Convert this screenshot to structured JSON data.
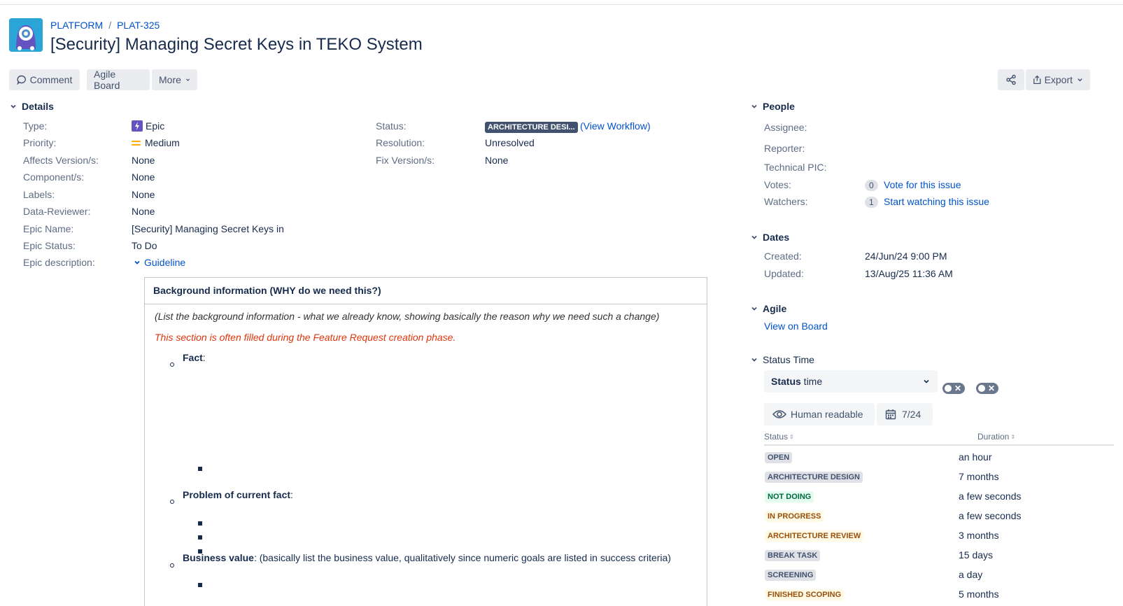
{
  "header": {
    "project": "PLATFORM",
    "issue_key": "PLAT-325",
    "title": "[Security] Managing Secret Keys in TEKO System"
  },
  "toolbar": {
    "comment": "Comment",
    "agile_board": "Agile Board",
    "more": "More",
    "export": "Export"
  },
  "details": {
    "heading": "Details",
    "type_label": "Type:",
    "type_value": "Epic",
    "priority_label": "Priority:",
    "priority_value": "Medium",
    "affects_label": "Affects Version/s:",
    "affects_value": "None",
    "components_label": "Component/s:",
    "components_value": "None",
    "labels_label": "Labels:",
    "labels_value": "None",
    "reviewer_label": "Data-Reviewer:",
    "reviewer_value": "None",
    "epic_name_label": "Epic Name:",
    "epic_name_value": "[Security] Managing Secret Keys in",
    "epic_status_label": "Epic Status:",
    "epic_status_value": "To Do",
    "epic_desc_label": "Epic description:",
    "epic_desc_toggle": "Guideline",
    "status_label": "Status:",
    "status_value": "ARCHITECTURE DESI...",
    "view_workflow": "(View Workflow)",
    "resolution_label": "Resolution:",
    "resolution_value": "Unresolved",
    "fix_label": "Fix Version/s:",
    "fix_value": "None"
  },
  "guideline": {
    "heading": "Background information (WHY do we need this?)",
    "intro": "(List the background information - what we already know, showing basically the reason why we need such a change)",
    "note": "This section is often filled during the Feature Request creation phase.",
    "fact": "Fact",
    "problem": "Problem of current fact",
    "business_value": "Business value",
    "business_value_desc": ": (basically list the business value, qualitatively since numeric goals are listed in success criteria)",
    "colon": ":"
  },
  "people": {
    "heading": "People",
    "assignee_label": "Assignee:",
    "reporter_label": "Reporter:",
    "technical_pic_label": "Technical PIC:",
    "votes_label": "Votes:",
    "votes_count": "0",
    "vote_link": "Vote for this issue",
    "watchers_label": "Watchers:",
    "watchers_count": "1",
    "watch_link": "Start watching this issue"
  },
  "dates": {
    "heading": "Dates",
    "created_label": "Created:",
    "created_value": "24/Jun/24 9:00 PM",
    "updated_label": "Updated:",
    "updated_value": "13/Aug/25 11:36 AM"
  },
  "agile": {
    "heading": "Agile",
    "view_on_board": "View on Board"
  },
  "status_time": {
    "heading": "Status Time",
    "select_bold": "Status",
    "select_rest": " time",
    "human_readable": "Human readable",
    "calendar_value": "7/24",
    "col_status": "Status",
    "col_duration": "Duration",
    "rows": [
      {
        "status": "OPEN",
        "duration": "an hour",
        "color": "grey"
      },
      {
        "status": "ARCHITECTURE DESIGN",
        "duration": "7 months",
        "color": "grey"
      },
      {
        "status": "NOT DOING",
        "duration": "a few seconds",
        "color": "green"
      },
      {
        "status": "IN PROGRESS",
        "duration": "a few seconds",
        "color": "yellow"
      },
      {
        "status": "ARCHITECTURE REVIEW",
        "duration": "3 months",
        "color": "yellow"
      },
      {
        "status": "BREAK TASK",
        "duration": "15 days",
        "color": "grey"
      },
      {
        "status": "SCREENING",
        "duration": "a day",
        "color": "grey"
      },
      {
        "status": "FINISHED SCOPING",
        "duration": "5 months",
        "color": "yellow"
      }
    ]
  }
}
